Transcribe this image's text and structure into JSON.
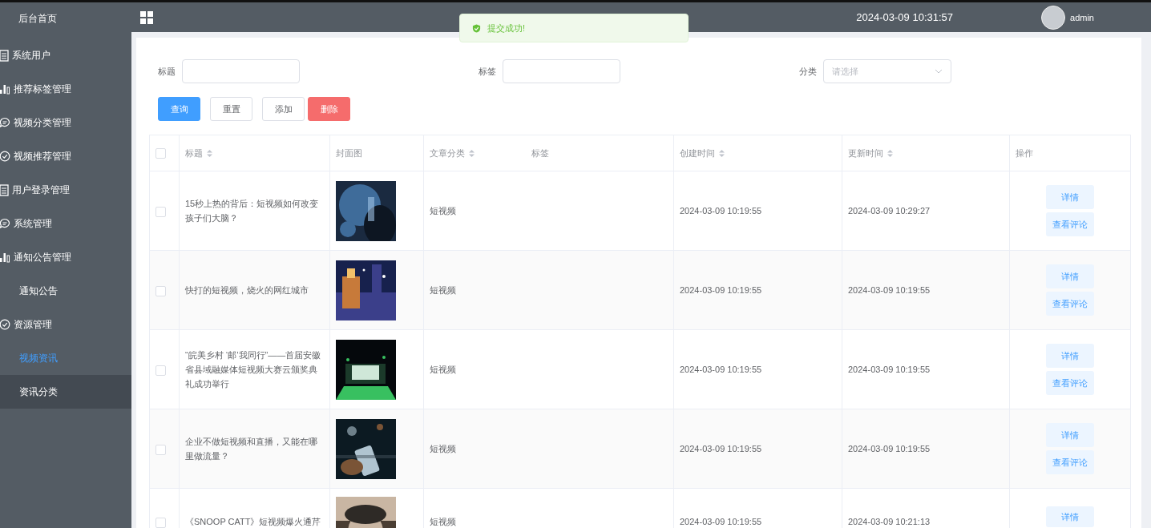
{
  "sidebar": {
    "items": [
      {
        "label": "后台首页",
        "kind": "plain",
        "selected": false,
        "hovered": false
      },
      {
        "label": "系统用户",
        "kind": "doc",
        "selected": false,
        "hovered": false
      },
      {
        "label": "推荐标签管理",
        "kind": "chart",
        "selected": false,
        "hovered": false
      },
      {
        "label": "视频分类管理",
        "kind": "chat",
        "selected": false,
        "hovered": false
      },
      {
        "label": "视频推荐管理",
        "kind": "check",
        "selected": false,
        "hovered": false
      },
      {
        "label": "用户登录管理",
        "kind": "doc",
        "selected": false,
        "hovered": false
      },
      {
        "label": "系统管理",
        "kind": "chat",
        "selected": false,
        "hovered": false
      },
      {
        "label": "通知公告管理",
        "kind": "chart",
        "selected": false,
        "hovered": false,
        "children": [
          {
            "label": "通知公告",
            "selected": false,
            "hovered": false
          }
        ]
      },
      {
        "label": "资源管理",
        "kind": "check",
        "selected": false,
        "hovered": false,
        "children": [
          {
            "label": "视频资讯",
            "selected": true,
            "hovered": false
          },
          {
            "label": "资讯分类",
            "selected": false,
            "hovered": true
          }
        ]
      }
    ]
  },
  "header": {
    "datetime": "2024-03-09 10:31:57",
    "user": "admin"
  },
  "toast": {
    "kind": "success",
    "message": "提交成功!"
  },
  "filters": [
    {
      "label": "标题",
      "kind": "text"
    },
    {
      "label": "标签",
      "kind": "text"
    },
    {
      "label": "分类",
      "kind": "select",
      "placeholder": "请选择"
    }
  ],
  "buttons": [
    {
      "label": "查询",
      "kind": "primary"
    },
    {
      "label": "重置",
      "kind": "default"
    },
    {
      "label": "添加",
      "kind": "default"
    },
    {
      "label": "删除",
      "kind": "danger"
    }
  ],
  "table": {
    "select_all": {
      "checked": false
    },
    "columns": [
      {
        "label": "标题",
        "sortable": true
      },
      {
        "label": "封面图",
        "sortable": false
      },
      {
        "label": "文章分类",
        "sortable": true
      },
      {
        "label": "标签",
        "sortable": false
      },
      {
        "label": "创建时间",
        "sortable": true
      },
      {
        "label": "更新时间",
        "sortable": true
      },
      {
        "label": "操作",
        "sortable": false
      }
    ],
    "rows": [
      {
        "checked": false,
        "title": "15秒上热的背后：短视频如何改变孩子们大脑？",
        "cover": {
          "kind": "picture"
        },
        "category": "短视频",
        "created": "2024-03-09 10:19:55",
        "updated": "2024-03-09 10:29:27",
        "actions": [
          "详情",
          "查看评论"
        ]
      },
      {
        "checked": false,
        "title": "快打的短视频，烧火的网红城市",
        "cover": {
          "kind": "picture"
        },
        "category": "短视频",
        "created": "2024-03-09 10:19:55",
        "updated": "2024-03-09 10:19:55",
        "actions": [
          "详情",
          "查看评论"
        ]
      },
      {
        "checked": false,
        "title": "“皖美乡村 ‘邮’我同行”——首届安徽省县域融媒体短视频大赛云颁奖典礼成功举行",
        "cover": {
          "kind": "picture"
        },
        "category": "短视频",
        "created": "2024-03-09 10:19:55",
        "updated": "2024-03-09 10:19:55",
        "actions": [
          "详情",
          "查看评论"
        ]
      },
      {
        "checked": false,
        "title": "企业不做短视频和直播，又能在哪里做流量？",
        "cover": {
          "kind": "picture"
        },
        "category": "短视频",
        "created": "2024-03-09 10:19:55",
        "updated": "2024-03-09 10:19:55",
        "actions": [
          "详情",
          "查看评论"
        ]
      },
      {
        "checked": false,
        "title": "《SNOOP CATT》短视频爆火通芹",
        "cover": {
          "kind": "picture"
        },
        "category": "短视频",
        "created": "2024-03-09 10:19:55",
        "updated": "2024-03-09 10:21:13",
        "actions": [
          "详情"
        ]
      }
    ]
  }
}
